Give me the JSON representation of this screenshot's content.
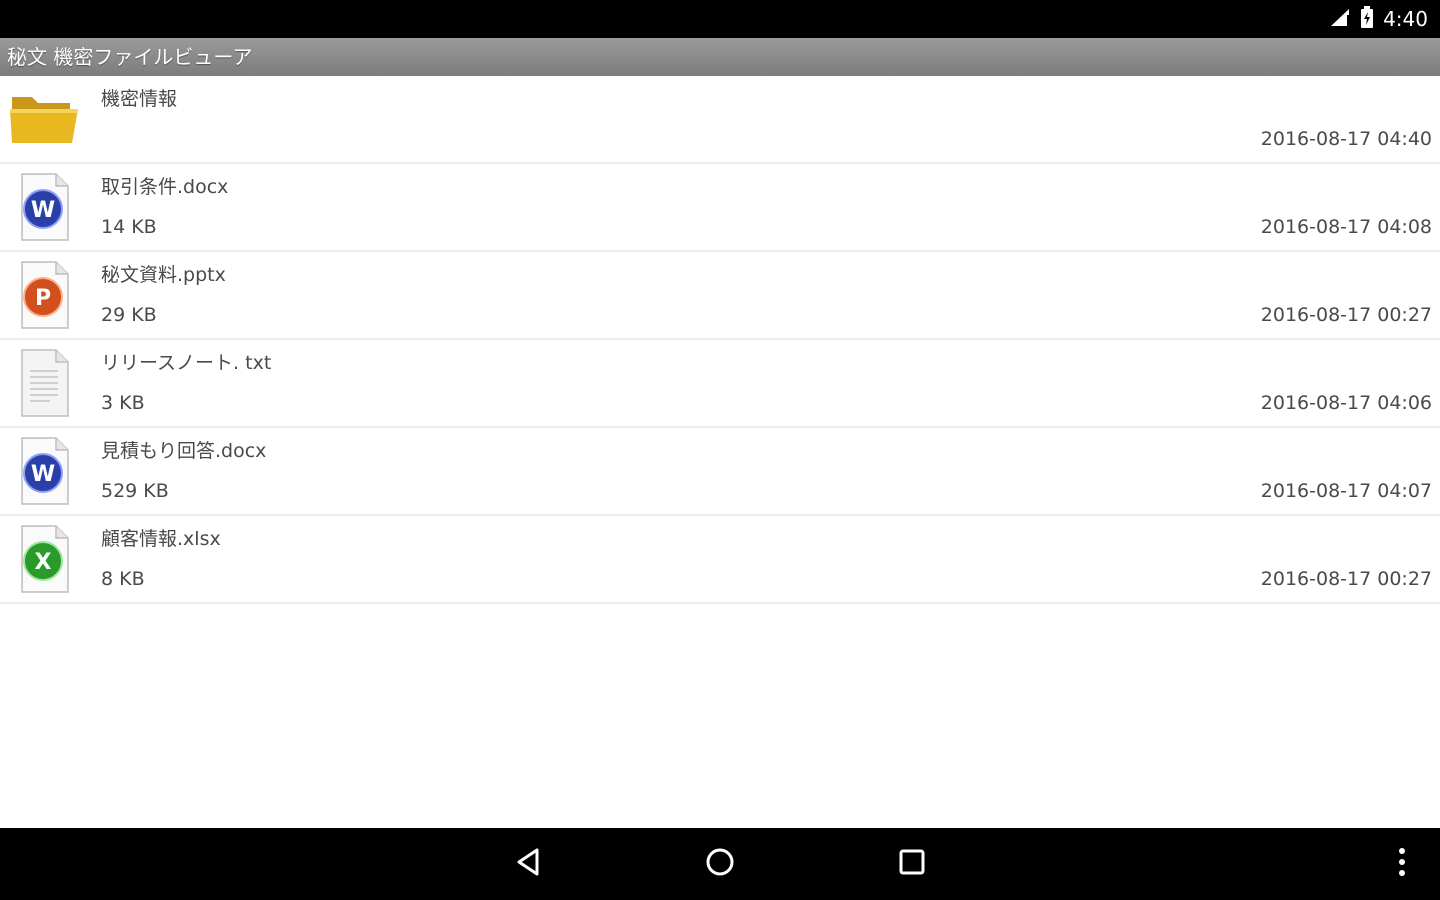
{
  "status_bar": {
    "time": "4:40",
    "icons": [
      "signal-icon",
      "battery-charging-icon"
    ]
  },
  "app": {
    "title": "秘文 機密ファイルビューア"
  },
  "files": [
    {
      "name": "機密情報",
      "size": "",
      "date": "2016-08-17 04:40",
      "icon": "folder-icon"
    },
    {
      "name": "取引条件.docx",
      "size": "14 KB",
      "date": "2016-08-17 04:08",
      "icon": "word-document-icon"
    },
    {
      "name": "秘文資料.pptx",
      "size": "29 KB",
      "date": "2016-08-17 00:27",
      "icon": "powerpoint-document-icon"
    },
    {
      "name": "リリースノート. txt",
      "size": "3 KB",
      "date": "2016-08-17 04:06",
      "icon": "text-document-icon"
    },
    {
      "name": "見積もり回答.docx",
      "size": "529 KB",
      "date": "2016-08-17 04:07",
      "icon": "word-document-icon"
    },
    {
      "name": "顧客情報.xlsx",
      "size": "8 KB",
      "date": "2016-08-17 00:27",
      "icon": "excel-document-icon"
    }
  ],
  "nav_bar": {
    "buttons": [
      "back-icon",
      "home-icon",
      "recents-icon",
      "overflow-menu-icon"
    ]
  },
  "colors": {
    "title_bar": "#8a8a8a",
    "folder": "#e8b820",
    "word": "#2a3fa8",
    "powerpoint": "#d2501e",
    "excel": "#2a9a2a",
    "text": "#4a4a4a"
  }
}
